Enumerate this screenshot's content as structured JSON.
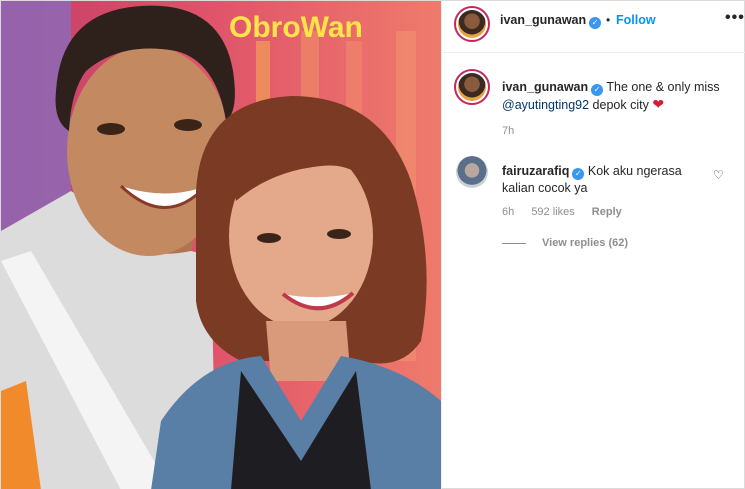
{
  "header": {
    "username": "ivan_gunawan",
    "verified_icon": "verified-badge-icon",
    "separator": "•",
    "follow_label": "Follow",
    "more_label": "•••"
  },
  "photo": {
    "sign_text": "ObroWan"
  },
  "caption": {
    "username": "ivan_gunawan",
    "text_before": "The one & only miss",
    "mention": "@ayutingting92",
    "text_after": "depok city",
    "emoji": "❤",
    "time": "7h"
  },
  "comment": {
    "username": "fairuzarafiq",
    "text": "Kok aku ngerasa kalian cocok ya",
    "time": "6h",
    "likes": "592 likes",
    "reply_label": "Reply",
    "like_icon": "♡"
  },
  "view_replies": "View replies (62)",
  "colors": {
    "accent": "#0095f6",
    "verified": "#3897f0",
    "heart": "#d9192c"
  }
}
